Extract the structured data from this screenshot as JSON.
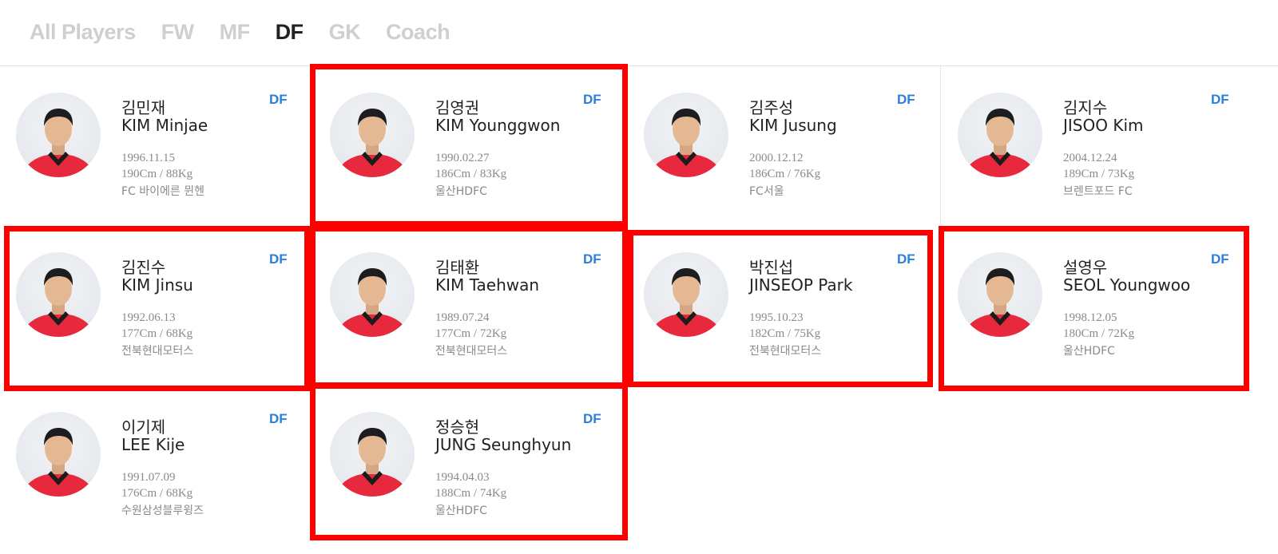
{
  "tabs": [
    {
      "label": "All Players",
      "active": false
    },
    {
      "label": "FW",
      "active": false
    },
    {
      "label": "MF",
      "active": false
    },
    {
      "label": "DF",
      "active": true
    },
    {
      "label": "GK",
      "active": false
    },
    {
      "label": "Coach",
      "active": false
    }
  ],
  "players": [
    {
      "name_ko": "김민재",
      "name_en": "KIM Minjae",
      "position": "DF",
      "birth": "1996.11.15",
      "body": "190Cm / 88Kg",
      "club": "FC 바이에른 뮌헨",
      "highlighted": false
    },
    {
      "name_ko": "김영권",
      "name_en": "KIM Younggwon",
      "position": "DF",
      "birth": "1990.02.27",
      "body": "186Cm / 83Kg",
      "club": "울산HDFC",
      "highlighted": true
    },
    {
      "name_ko": "김주성",
      "name_en": "KIM Jusung",
      "position": "DF",
      "birth": "2000.12.12",
      "body": "186Cm / 76Kg",
      "club": "FC서울",
      "highlighted": false
    },
    {
      "name_ko": "김지수",
      "name_en": "JISOO Kim",
      "position": "DF",
      "birth": "2004.12.24",
      "body": "189Cm / 73Kg",
      "club": "브렌트포드 FC",
      "highlighted": false
    },
    {
      "name_ko": "김진수",
      "name_en": "KIM Jinsu",
      "position": "DF",
      "birth": "1992.06.13",
      "body": "177Cm / 68Kg",
      "club": "전북현대모터스",
      "highlighted": true
    },
    {
      "name_ko": "김태환",
      "name_en": "KIM Taehwan",
      "position": "DF",
      "birth": "1989.07.24",
      "body": "177Cm / 72Kg",
      "club": "전북현대모터스",
      "highlighted": true
    },
    {
      "name_ko": "박진섭",
      "name_en": "JINSEOP Park",
      "position": "DF",
      "birth": "1995.10.23",
      "body": "182Cm / 75Kg",
      "club": "전북현대모터스",
      "highlighted": true
    },
    {
      "name_ko": "설영우",
      "name_en": "SEOL Youngwoo",
      "position": "DF",
      "birth": "1998.12.05",
      "body": "180Cm / 72Kg",
      "club": "울산HDFC",
      "highlighted": true
    },
    {
      "name_ko": "이기제",
      "name_en": "LEE Kije",
      "position": "DF",
      "birth": "1991.07.09",
      "body": "176Cm / 68Kg",
      "club": "수원삼성블루윙즈",
      "highlighted": false
    },
    {
      "name_ko": "정승현",
      "name_en": "JUNG Seunghyun",
      "position": "DF",
      "birth": "1994.04.03",
      "body": "188Cm / 74Kg",
      "club": "울산HDFC",
      "highlighted": true
    }
  ],
  "colors": {
    "accent": "#2b7fd9",
    "highlight": "#ff0000",
    "jersey": "#e8283c"
  }
}
